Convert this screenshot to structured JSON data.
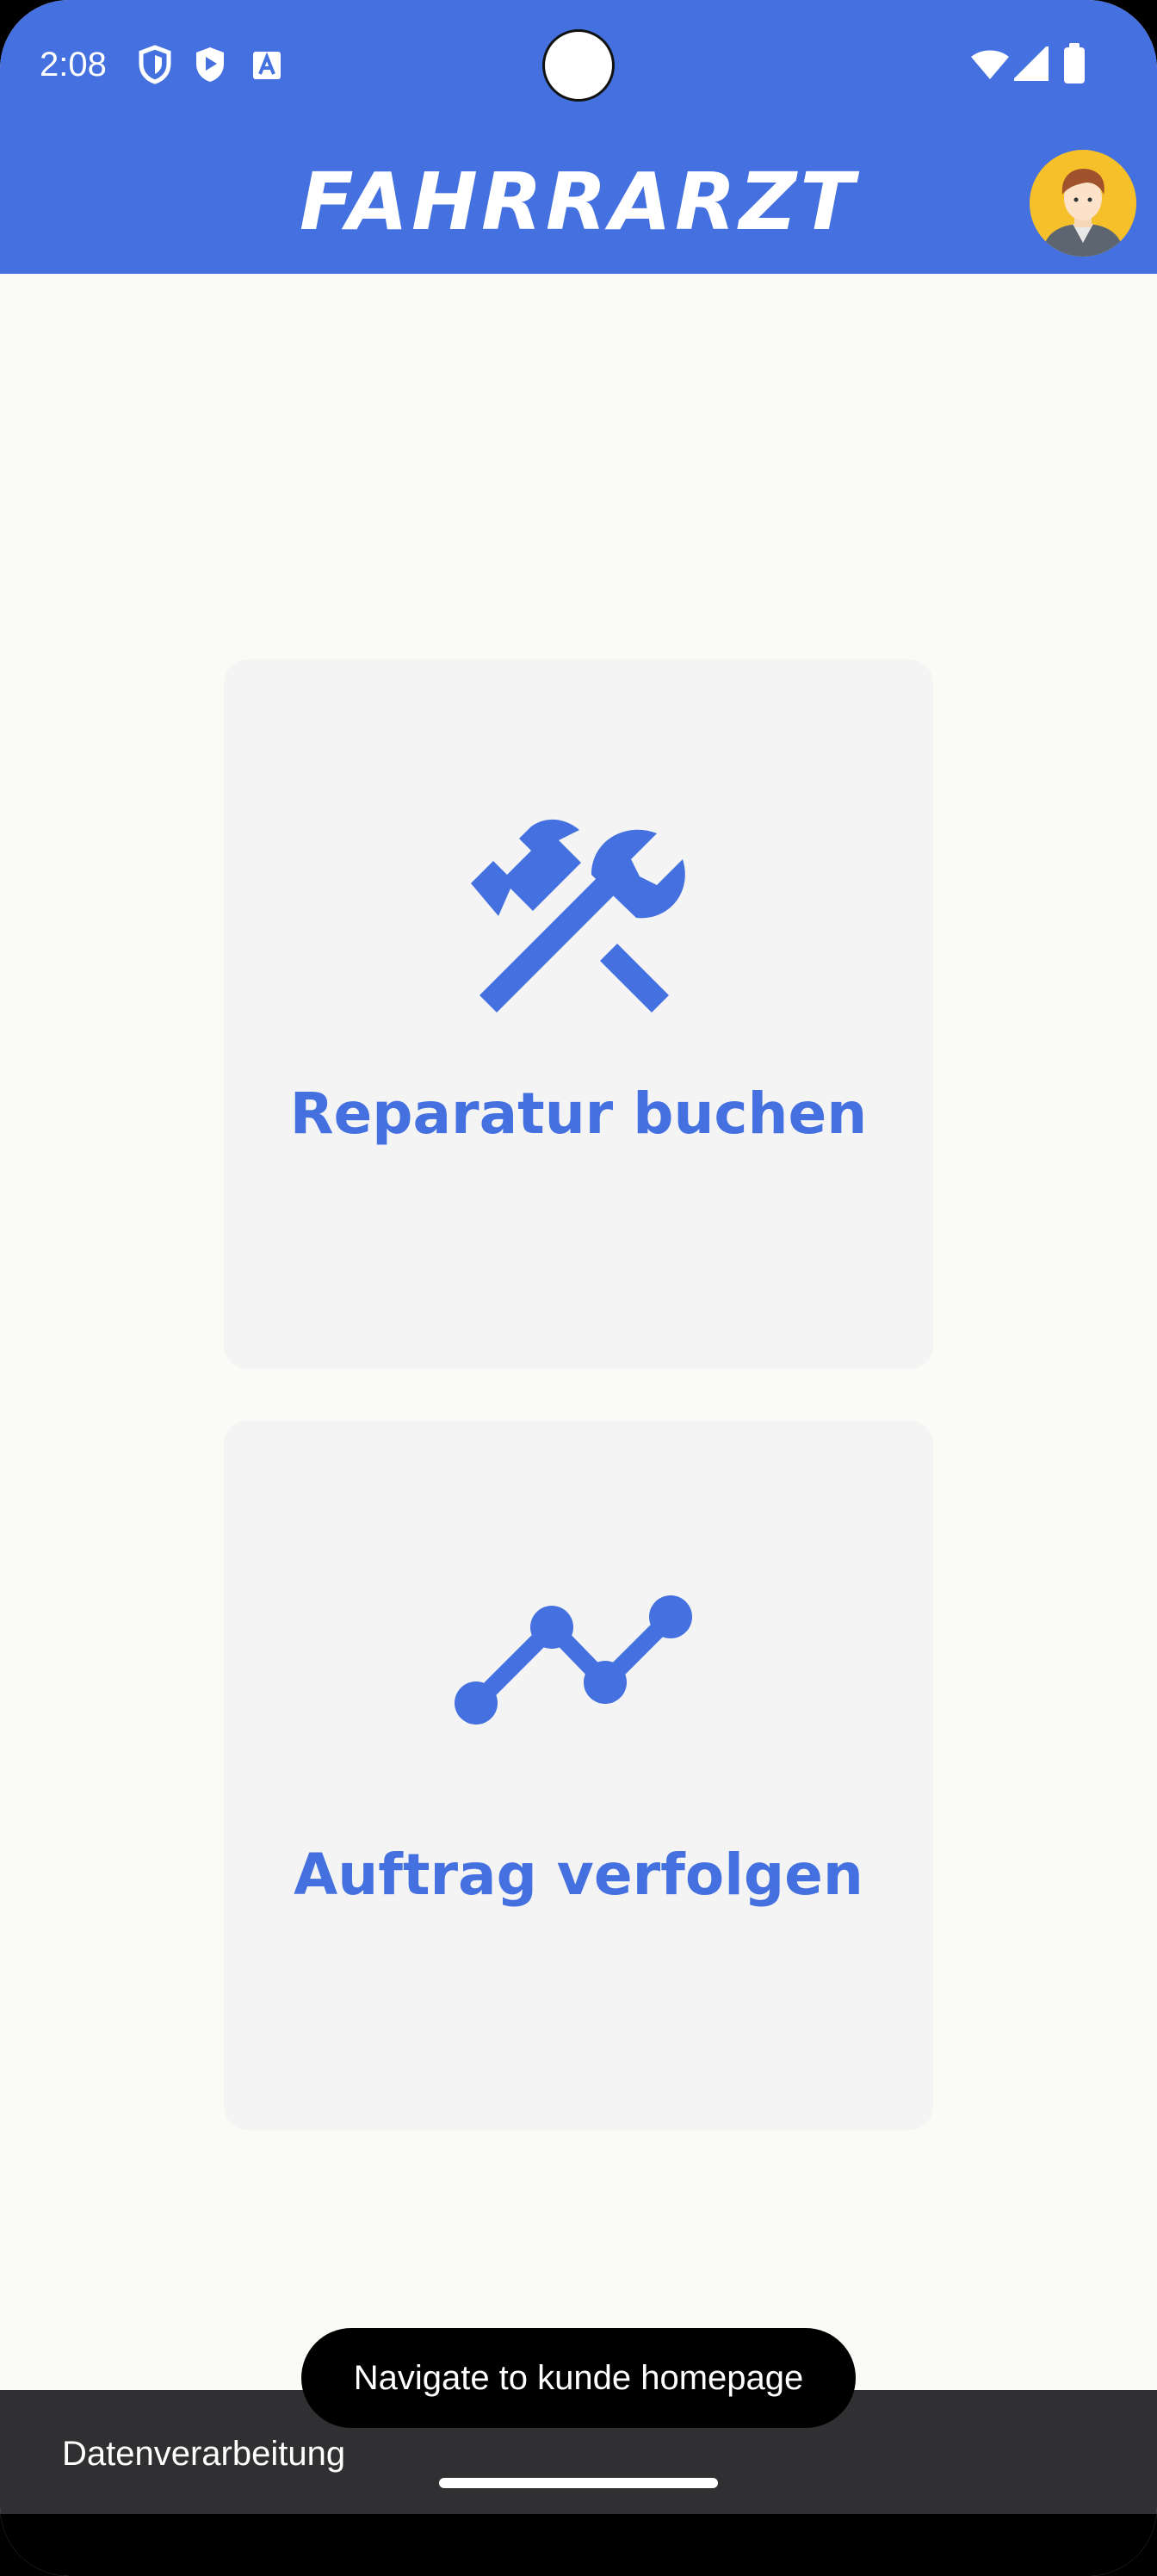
{
  "status_bar": {
    "time": "2:08",
    "icons": [
      "shield-icon",
      "play-protect-icon",
      "font-a-icon",
      "wifi-icon",
      "signal-icon",
      "battery-icon"
    ]
  },
  "app_bar": {
    "title": "FAHRRARZT",
    "profile_icon": "avatar-icon"
  },
  "cards": [
    {
      "label": "Reparatur buchen",
      "icon": "tools-icon"
    },
    {
      "label": "Auftrag verfolgen",
      "icon": "tracking-line-icon"
    }
  ],
  "snackbar": {
    "text": "Datenverarbeitung"
  },
  "toast": {
    "text": "Navigate to kunde homepage"
  },
  "colors": {
    "primary": "#4571e0",
    "background": "#fafaf6",
    "card": "#f4f4f5",
    "snackbar": "#303032",
    "avatar_bg": "#f6c02a"
  }
}
